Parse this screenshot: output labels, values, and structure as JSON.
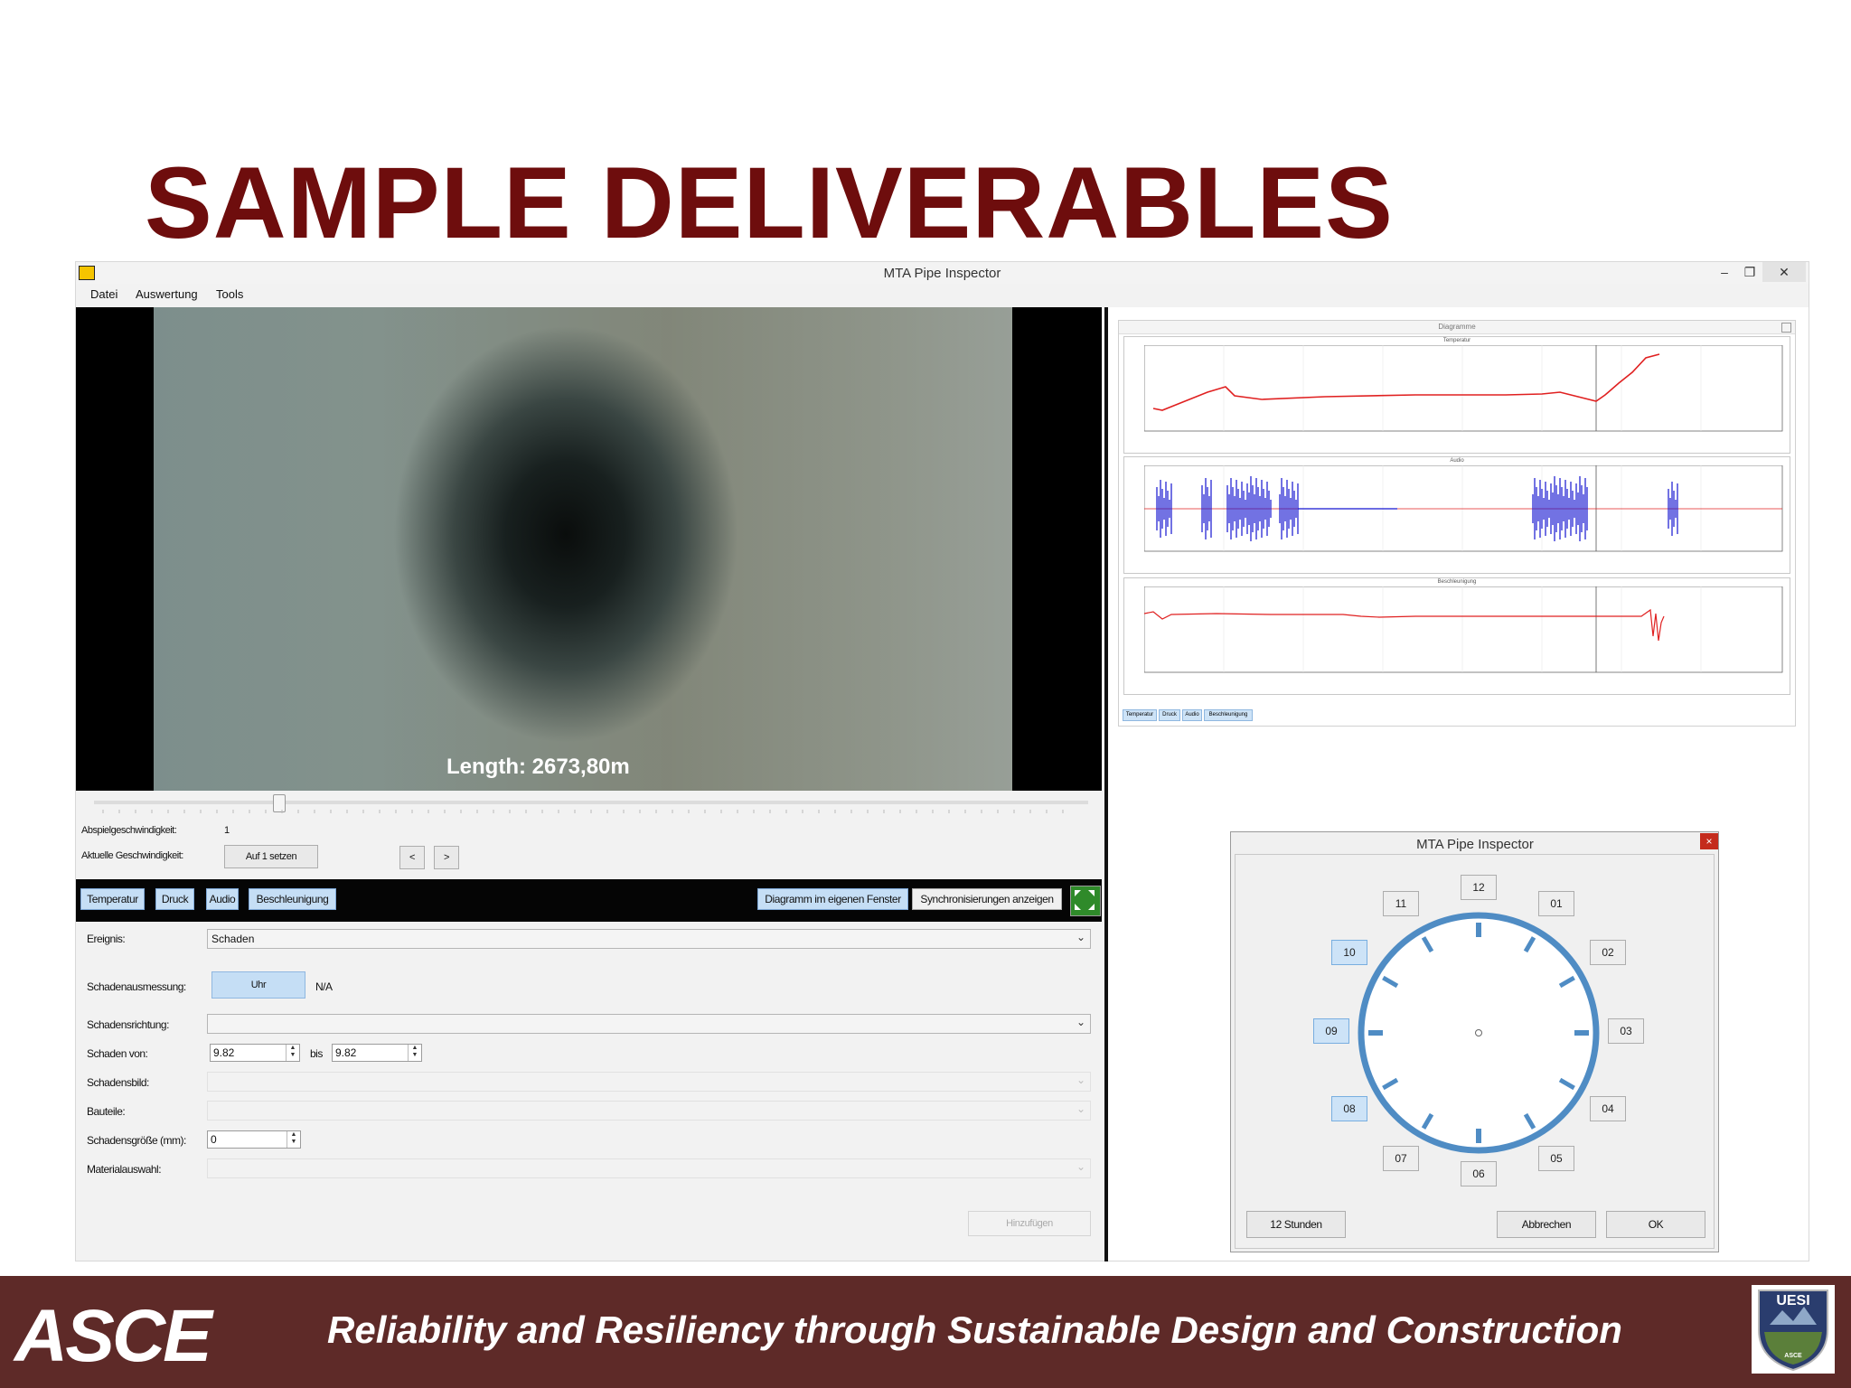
{
  "slide": {
    "title": "SAMPLE DELIVERABLES"
  },
  "window": {
    "title": "MTA Pipe Inspector",
    "menu": [
      "Datei",
      "Auswertung",
      "Tools"
    ]
  },
  "video": {
    "overlay_text": "Length: 2673,80m"
  },
  "playback": {
    "slider_position": 0.18,
    "speed_label": "Abspielgeschwindigkeit:",
    "speed_value": "1",
    "current_speed_label": "Aktuelle Geschwindigkeit:",
    "reset_button": "Auf 1 setzen",
    "prev_button": "<",
    "next_button": ">"
  },
  "toolbar": {
    "tabs": [
      "Temperatur",
      "Druck",
      "Audio",
      "Beschleunigung"
    ],
    "diagram_window_button": "Diagramm im eigenen Fenster",
    "sync_button": "Synchronisierungen anzeigen"
  },
  "form": {
    "event_label": "Ereignis:",
    "event_value": "Schaden",
    "measure_label": "Schadenausmessung:",
    "measure_button": "Uhr",
    "measure_value": "N/A",
    "direction_label": "Schadensrichtung:",
    "from_label": "Schaden von:",
    "from_value": "9.82",
    "to_label": "bis",
    "to_value": "9.82",
    "image_label": "Schadensbild:",
    "parts_label": "Bauteile:",
    "size_label": "Schadensgröße (mm):",
    "size_value": "0",
    "material_label": "Materialauswahl:",
    "add_button": "Hinzufügen"
  },
  "diagram_panel": {
    "title": "Diagramme",
    "tabs": [
      "Temperatur",
      "Druck",
      "Audio",
      "Beschleunigung"
    ],
    "charts": [
      "Temperatur",
      "Audio",
      "Beschleunigung"
    ],
    "series_colors": {
      "temperature": "#e02020",
      "audio": "#1414d0",
      "acceleration": "#e02020"
    }
  },
  "clock_dialog": {
    "title": "MTA Pipe Inspector",
    "close": "×",
    "hours": [
      "12",
      "01",
      "02",
      "03",
      "04",
      "05",
      "06",
      "07",
      "08",
      "09",
      "10",
      "11"
    ],
    "active_hours": [
      "08",
      "09",
      "10"
    ],
    "mode_button": "12 Stunden",
    "cancel_button": "Abbrechen",
    "ok_button": "OK"
  },
  "footer": {
    "logo": "ASCE",
    "tagline": "Reliability and Resiliency through Sustainable Design and Construction",
    "badge_text": "UESI",
    "badge_subtext": "ASCE"
  },
  "colors": {
    "title": "#6e0d0d",
    "footer": "#5e2a28",
    "accent_blue": "#c5def5",
    "clock_ring": "#4f8cc4"
  }
}
